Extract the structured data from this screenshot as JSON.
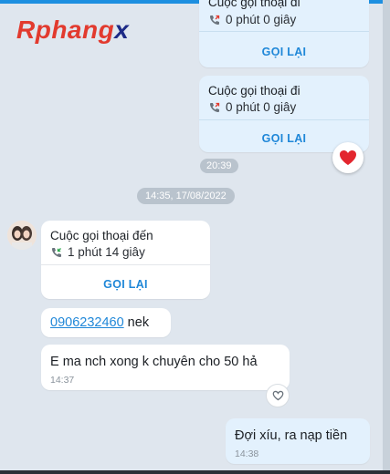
{
  "brand": {
    "logo_main": "Rphang",
    "logo_x": "x"
  },
  "calls": {
    "outgoing_1": {
      "title": "Cuộc gọi thoại đi",
      "duration": "0 phút 0 giây",
      "action": "GỌI LẠI"
    },
    "outgoing_2": {
      "title": "Cuộc gọi thoại đi",
      "duration": "0 phút 0 giây",
      "action": "GỌI LẠI"
    },
    "outgoing_time": "20:39",
    "incoming": {
      "title": "Cuộc gọi thoại đến",
      "duration": "1 phút 14 giây",
      "action": "GỌI LẠI"
    }
  },
  "date_separator": "14:35, 17/08/2022",
  "messages": {
    "phone": {
      "number": "0906232460",
      "suffix": " nek"
    },
    "question": {
      "text": "E ma nch xong k chuyên cho 50 hả",
      "time": "14:37"
    },
    "reply": {
      "text": "Đợi xíu, ra nạp tiền",
      "time": "14:38"
    }
  },
  "colors": {
    "accent": "#1f87d8",
    "sent_bubble": "#e3f1fd",
    "background": "#dfe6ee",
    "heart": "#e3262e"
  },
  "icons": {
    "outgoing": "outgoing-call-icon",
    "incoming": "incoming-call-icon",
    "reaction": "heart-icon",
    "like": "heart-outline-icon"
  }
}
